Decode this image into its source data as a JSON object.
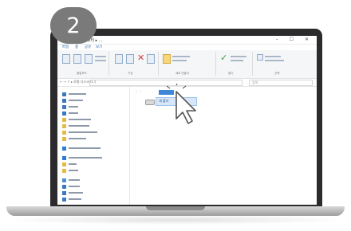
{
  "step_badge": {
    "number": "2"
  },
  "explorer": {
    "window_title": "▾ 내 컴퓨터 ▸ ...",
    "title_controls": "– ☐ ✕",
    "tabs": [
      "파일",
      "홈",
      "공유",
      "보기"
    ],
    "ribbon_groups": [
      "클립보드",
      "구성",
      "새로 만들기",
      "열기",
      "선택"
    ],
    "address": "← → ↑  ▸ 로컬 디스크 (C:)",
    "search_placeholder": "검색",
    "nav_items": [
      {
        "label": "바탕 화면",
        "icon": "desktop-icon"
      },
      {
        "label": "다운로드",
        "icon": "download-icon"
      },
      {
        "label": "문서",
        "icon": "documents-icon"
      },
      {
        "label": "사진",
        "icon": "pictures-icon"
      },
      {
        "label": "스크린샷",
        "icon": "folder-icon"
      },
      {
        "label": "새 폴더",
        "icon": "folder-icon"
      },
      {
        "label": "프로젝트",
        "icon": "folder-icon"
      },
      {
        "label": "업무 자료",
        "icon": "folder-icon"
      },
      {
        "label": "OneDrive",
        "icon": "cloud-icon"
      },
      {
        "label": "OneDrive - Personal",
        "icon": "cloud-icon"
      },
      {
        "label": "내 PC",
        "icon": "computer-icon"
      },
      {
        "label": "네트워크",
        "icon": "network-icon"
      }
    ],
    "selected_item_label": "새 폴더"
  }
}
